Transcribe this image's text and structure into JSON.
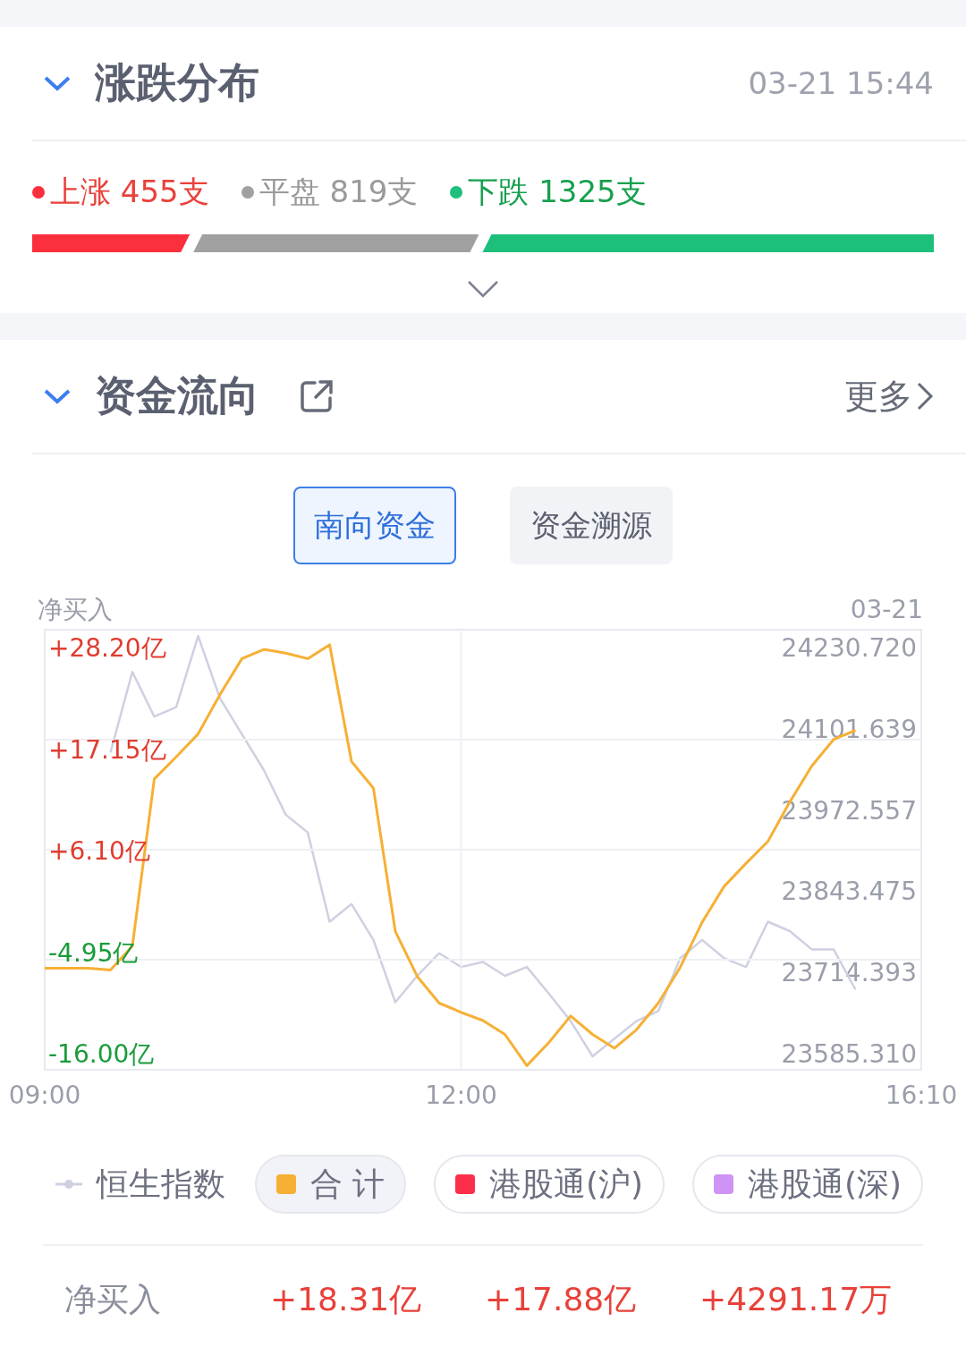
{
  "distribution": {
    "title": "涨跌分布",
    "time": "03-21 15:44",
    "expanded": true,
    "segments": [
      {
        "label": "上涨 455支",
        "color": "#fc2f3d"
      },
      {
        "label": "平盘 819支",
        "color": "#a0a0a0"
      },
      {
        "label": "下跌 1325支",
        "color": "#1dbf7a"
      }
    ]
  },
  "fund_flow": {
    "title": "资金流向",
    "expanded": true,
    "more": "更多",
    "tabs": [
      {
        "label": "南向资金",
        "selected": true
      },
      {
        "label": "资金溯源",
        "selected": false
      }
    ],
    "chart": {
      "left_title": "净买入",
      "right_title": "03-21",
      "chart_data": {
        "type": "line",
        "categories": [
          "09:00",
          null,
          null,
          null,
          null,
          null,
          null,
          null,
          null,
          null,
          null,
          null,
          null,
          null,
          null,
          null,
          null,
          null,
          null,
          "12:00",
          null,
          null,
          null,
          null,
          null,
          null,
          null,
          null,
          null,
          null,
          null,
          null,
          null,
          null,
          null,
          null,
          null,
          null,
          null,
          null,
          "16:10"
        ],
        "ylim": [
          -17.75,
          30.15
        ],
        "yticks": [
          {
            "value": 28.2,
            "label": "+28.20亿"
          },
          {
            "value": 17.15,
            "label": "+17.15亿"
          },
          {
            "value": 6.1,
            "label": "+6.10亿"
          },
          {
            "value": -4.95,
            "label": "-4.95亿"
          },
          {
            "value": -16,
            "label": "-16.00亿"
          }
        ],
        "series": [
          {
            "color": "#f6b035",
            "values": [
              -6.7,
              -6.7,
              -6.7,
              -6.9,
              -4.3,
              13.9,
              16.3,
              18.8,
              23.1,
              27.0,
              28.0,
              27.6,
              27.0,
              28.5,
              15.8,
              12.9,
              -2.7,
              -7.6,
              -10.5,
              -11.5,
              -12.4,
              -13.9,
              -17.3,
              -14.8,
              -11.9,
              -13.9,
              -15.4,
              -13.4,
              -10.5,
              -6.6,
              -1.7,
              2.2,
              4.7,
              7.1,
              11.4,
              15.3,
              18.2,
              19.2,
              null,
              null,
              null
            ]
          }
        ]
      }
    },
    "index_chart": {
      "chart_data": {
        "type": "line",
        "ylim": [
          23559.72,
          24259.15
        ],
        "yticks": [
          {
            "value": 24230.72,
            "label": "24230.720"
          },
          {
            "value": 24101.639,
            "label": "24101.639"
          },
          {
            "value": 23972.557,
            "label": "23972.557"
          },
          {
            "value": 23843.475,
            "label": "23843.475"
          },
          {
            "value": 23714.393,
            "label": "23714.393"
          },
          {
            "value": 23585.31,
            "label": "23585.310"
          }
        ],
        "series": [
          {
            "color": "#cfd0e0",
            "values": [
              null,
              null,
              null,
              24064,
              24192,
              24121,
              24136,
              24249,
              24150,
              24093,
              24036,
              23965,
              23937,
              23795,
              23823,
              23766,
              23667,
              23709,
              23745,
              23723,
              23731,
              23709,
              23723,
              23681,
              23637,
              23581,
              23609,
              23637,
              23653,
              23737,
              23766,
              23737,
              23723,
              23795,
              23780,
              23751,
              23751,
              23687,
              null,
              null,
              null
            ]
          }
        ]
      }
    },
    "legend": [
      {
        "label": "恒生指数",
        "kind": "line",
        "color": "#cfd0e0",
        "selected": false
      },
      {
        "label": "合 计",
        "kind": "box",
        "color": "#f6b035",
        "selected": true
      },
      {
        "label": "港股通(沪)",
        "kind": "box",
        "color": "#fc2f4a",
        "selected": false
      },
      {
        "label": "港股通(深)",
        "kind": "box",
        "color": "#cf92f5",
        "selected": false
      }
    ],
    "summary": {
      "label": "净买入",
      "values": [
        "+18.31亿",
        "+17.88亿",
        "+4291.17万"
      ]
    }
  }
}
